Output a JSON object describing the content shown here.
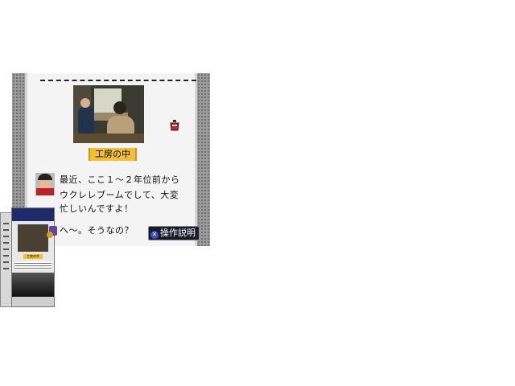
{
  "screen": {
    "photo_caption": "工房の中",
    "dialogue": {
      "line1": "最近、ここ１～２年位前から",
      "line2": "ウクレレブームでして、大変",
      "line3": "忙しいんですよ！",
      "reply": "へ～。そうなの？"
    },
    "help_button": {
      "icon": "x-button-icon",
      "label": "操作説明"
    }
  },
  "box_art": {
    "caption": "工房の中"
  },
  "colors": {
    "caption_bg": "#f0c030",
    "panel_bg": "#f4f4f4",
    "rail": "#9c9c9c",
    "help_bg": "#1a1a2a"
  }
}
